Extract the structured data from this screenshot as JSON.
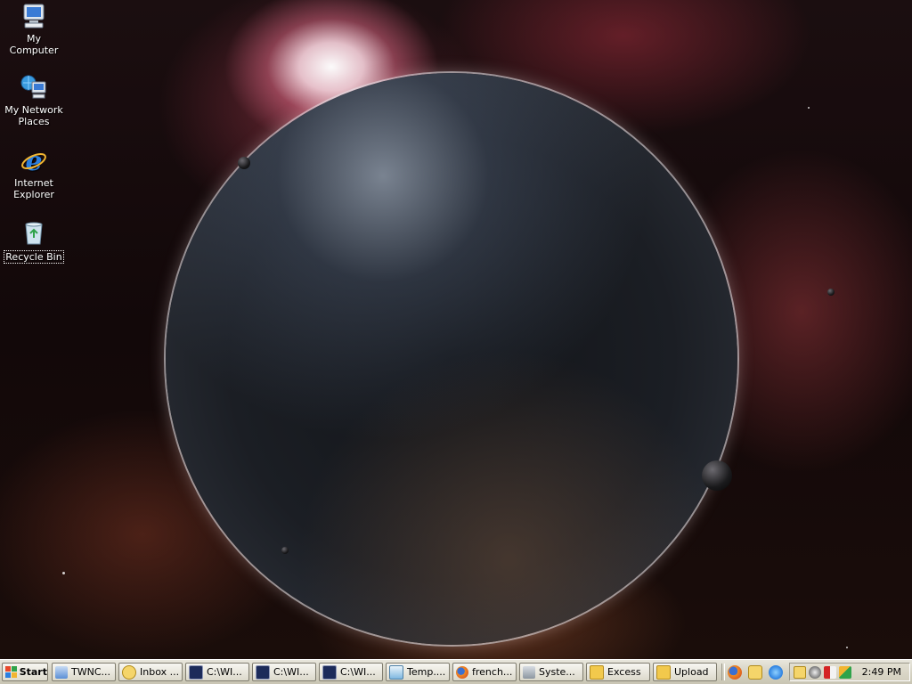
{
  "desktop": {
    "icons": [
      {
        "label": "My Computer",
        "icon": "my-computer-icon"
      },
      {
        "label": "My Network Places",
        "icon": "network-places-icon"
      },
      {
        "label": "Internet Explorer",
        "icon": "internet-explorer-icon"
      },
      {
        "label": "Recycle Bin",
        "icon": "recycle-bin-icon",
        "selected": true
      }
    ]
  },
  "taskbar": {
    "start_label": "Start",
    "quick_launch": [
      "firefox-icon",
      "clock-app-icon",
      "internet-explorer-icon"
    ],
    "tasks": [
      {
        "label": "TWNC...",
        "icon": "twnc-icon"
      },
      {
        "label": "Inbox ...",
        "icon": "mail-icon"
      },
      {
        "label": "C:\\WI...",
        "icon": "command-prompt-icon"
      },
      {
        "label": "C:\\WI...",
        "icon": "command-prompt-icon"
      },
      {
        "label": "C:\\WI...",
        "icon": "command-prompt-icon"
      },
      {
        "label": "Temp....",
        "icon": "notepad-icon"
      },
      {
        "label": "french...",
        "icon": "firefox-icon"
      },
      {
        "label": "Syste...",
        "icon": "system-icon"
      },
      {
        "label": "Excess",
        "icon": "folder-icon"
      },
      {
        "label": "Upload",
        "icon": "folder-icon"
      }
    ],
    "tray": {
      "icons": [
        "clock-app-icon",
        "gear-icon",
        "red-alert-icon",
        "pen-icon"
      ],
      "clock": "2:49 PM"
    }
  },
  "colors": {
    "taskbar": "#d6d3c4",
    "folder": "#f2c94c",
    "console": "#1c2b5a"
  }
}
